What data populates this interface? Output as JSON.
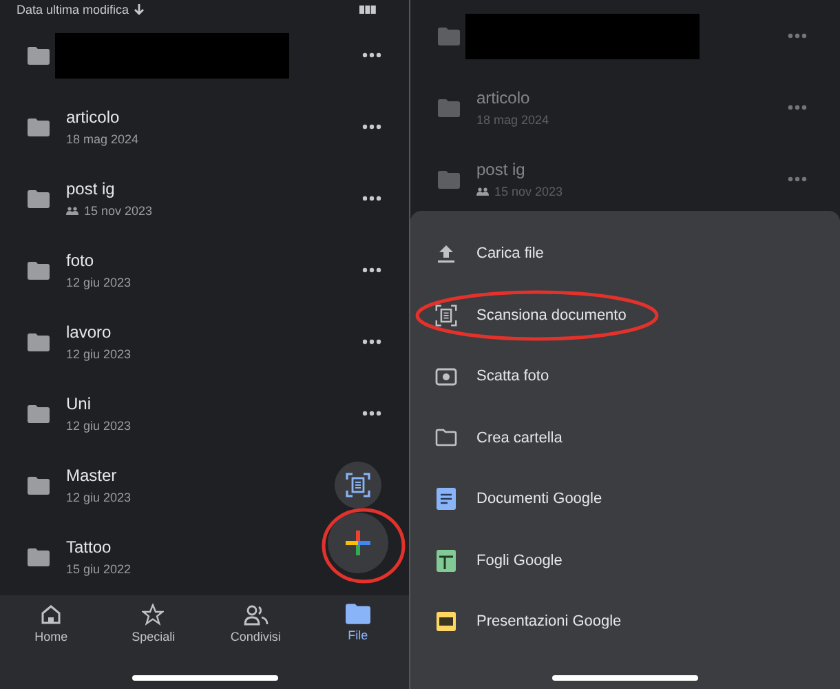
{
  "left": {
    "sort_label": "Data ultima modifica",
    "files": [
      {
        "kind": "redacted"
      },
      {
        "kind": "folder",
        "name": "articolo",
        "date": "18 mag 2024",
        "shared": false
      },
      {
        "kind": "folder",
        "name": "post ig",
        "date": "15 nov 2023",
        "shared": true
      },
      {
        "kind": "folder",
        "name": "foto",
        "date": "12 giu 2023",
        "shared": false
      },
      {
        "kind": "folder",
        "name": "lavoro",
        "date": "12 giu 2023",
        "shared": false
      },
      {
        "kind": "folder",
        "name": "Uni",
        "date": "12 giu 2023",
        "shared": false
      },
      {
        "kind": "folder",
        "name": "Master",
        "date": "12 giu 2023",
        "shared": false
      },
      {
        "kind": "folder",
        "name": "Tattoo",
        "date": "15 giu 2022",
        "shared": false
      }
    ],
    "nav": [
      {
        "label": "Home",
        "selected": false
      },
      {
        "label": "Speciali",
        "selected": false
      },
      {
        "label": "Condivisi",
        "selected": false
      },
      {
        "label": "File",
        "selected": true
      }
    ]
  },
  "right": {
    "files": [
      {
        "kind": "redacted"
      },
      {
        "kind": "folder",
        "name": "articolo",
        "date": "18 mag 2024",
        "shared": false
      },
      {
        "kind": "folder",
        "name": "post ig",
        "date": "15 nov 2023",
        "shared": true
      }
    ],
    "menu": [
      {
        "label": "Carica file",
        "highlighted": false
      },
      {
        "label": "Scansiona documento",
        "highlighted": true
      },
      {
        "label": "Scatta foto",
        "highlighted": false
      },
      {
        "label": "Crea cartella",
        "highlighted": false
      },
      {
        "label": "Documenti Google",
        "highlighted": false
      },
      {
        "label": "Fogli Google",
        "highlighted": false
      },
      {
        "label": "Presentazioni Google",
        "highlighted": false
      }
    ]
  }
}
